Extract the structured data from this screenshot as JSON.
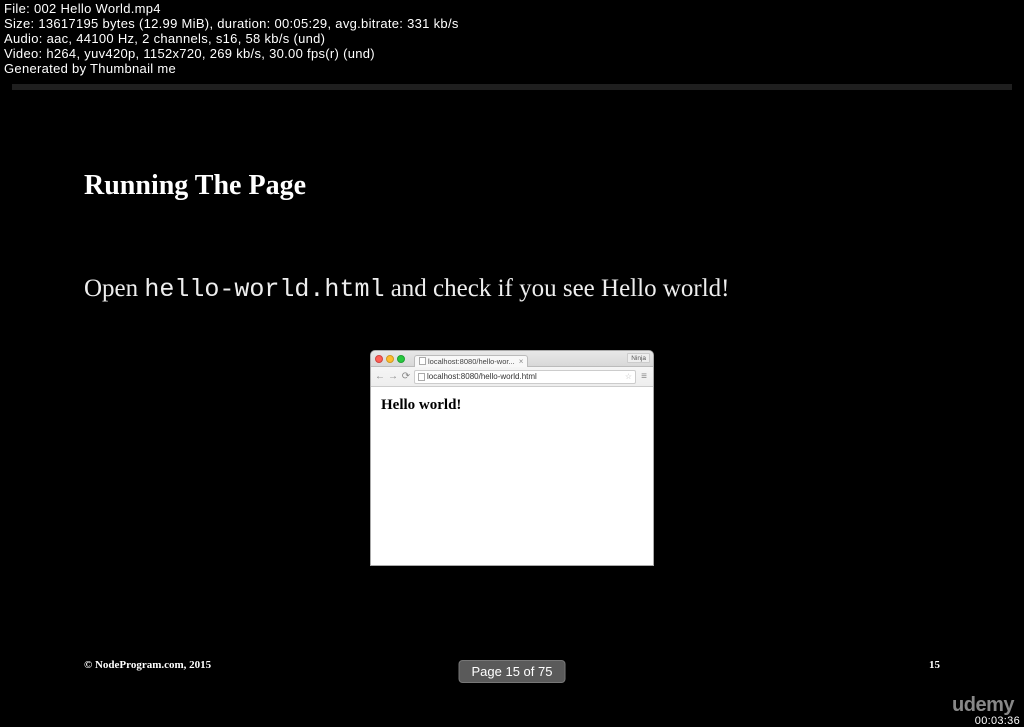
{
  "meta": {
    "line1": "File: 002 Hello World.mp4",
    "line2": "Size: 13617195 bytes (12.99 MiB), duration: 00:05:29, avg.bitrate: 331 kb/s",
    "line3": "Audio: aac, 44100 Hz, 2 channels, s16, 58 kb/s (und)",
    "line4": "Video: h264, yuv420p, 1152x720, 269 kb/s, 30.00 fps(r) (und)",
    "line5": "Generated by Thumbnail me"
  },
  "slide": {
    "title": "Running The Page",
    "body_prefix": "Open ",
    "body_code": "hello-world.html",
    "body_suffix": " and check if you see Hello world!",
    "footer_left": "© NodeProgram.com, 2015",
    "footer_right": "15"
  },
  "browser": {
    "tab_title": "localhost:8080/hello-wor...",
    "ninja": "Ninja",
    "url": "localhost:8080/hello-world.html",
    "content": "Hello world!"
  },
  "page_indicator": "Page 15 of 75",
  "udemy": "udemy",
  "timestamp": "00:03:36"
}
